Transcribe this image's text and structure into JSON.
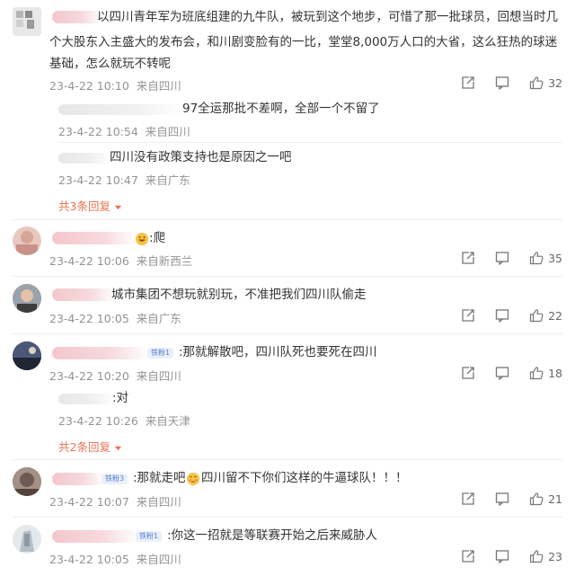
{
  "comments": [
    {
      "text_lines": [
        "以四川青年军为班底组建的九牛队，被玩到这个地步，可惜了那一批球员，回想当时几",
        "个大股东入主盛大的发布会，和川剧变脸有的一比，堂堂8,000万人口的大省，这么狂热的球迷",
        "基础，怎么就玩不转呢"
      ],
      "date": "23-4-22 10:10",
      "location": "来自四川",
      "likes": "32",
      "replies": [
        {
          "text": "97全运那批不差啊，全部一个不留了",
          "date": "23-4-22 10:54",
          "location": "来自四川"
        },
        {
          "text": "四川没有政策支持也是原因之一吧",
          "date": "23-4-22 10:47",
          "location": "来自广东"
        }
      ],
      "more_replies": "共3条回复"
    },
    {
      "text": ":爬",
      "date": "23-4-22 10:06",
      "location": "来自新西兰",
      "likes": "35"
    },
    {
      "text": "城市集团不想玩就别玩，不准把我们四川队偷走",
      "date": "23-4-22 10:05",
      "location": "来自广东",
      "likes": "22"
    },
    {
      "badge": "铁粉1",
      "text": ":那就解散吧，四川队死也要死在四川",
      "date": "23-4-22 10:20",
      "location": "来自四川",
      "likes": "18",
      "replies": [
        {
          "text": ":对",
          "date": "23-4-22 10:26",
          "location": "来自天津"
        }
      ],
      "more_replies": "共2条回复"
    },
    {
      "badge": "铁粉3",
      "text_a": ":那就走吧",
      "text_b": "四川留不下你们这样的牛逼球队！！！",
      "date": "23-4-22 10:07",
      "location": "来自四川",
      "likes": "21"
    },
    {
      "badge": "铁粉1",
      "text": ":你这一招就是等联赛开始之后来威胁人",
      "date": "23-4-22 10:05",
      "location": "来自四川",
      "likes": "23"
    }
  ],
  "icons": [
    "share-icon",
    "comment-icon",
    "like-icon",
    "chevron-down-icon",
    "grin-emoji",
    "blush-emoji"
  ],
  "colors": {
    "link": "#eb7350",
    "meta": "#939393",
    "text": "#333333",
    "badge_bg": "#e8f0fc",
    "badge_text": "#5a7ec7"
  }
}
